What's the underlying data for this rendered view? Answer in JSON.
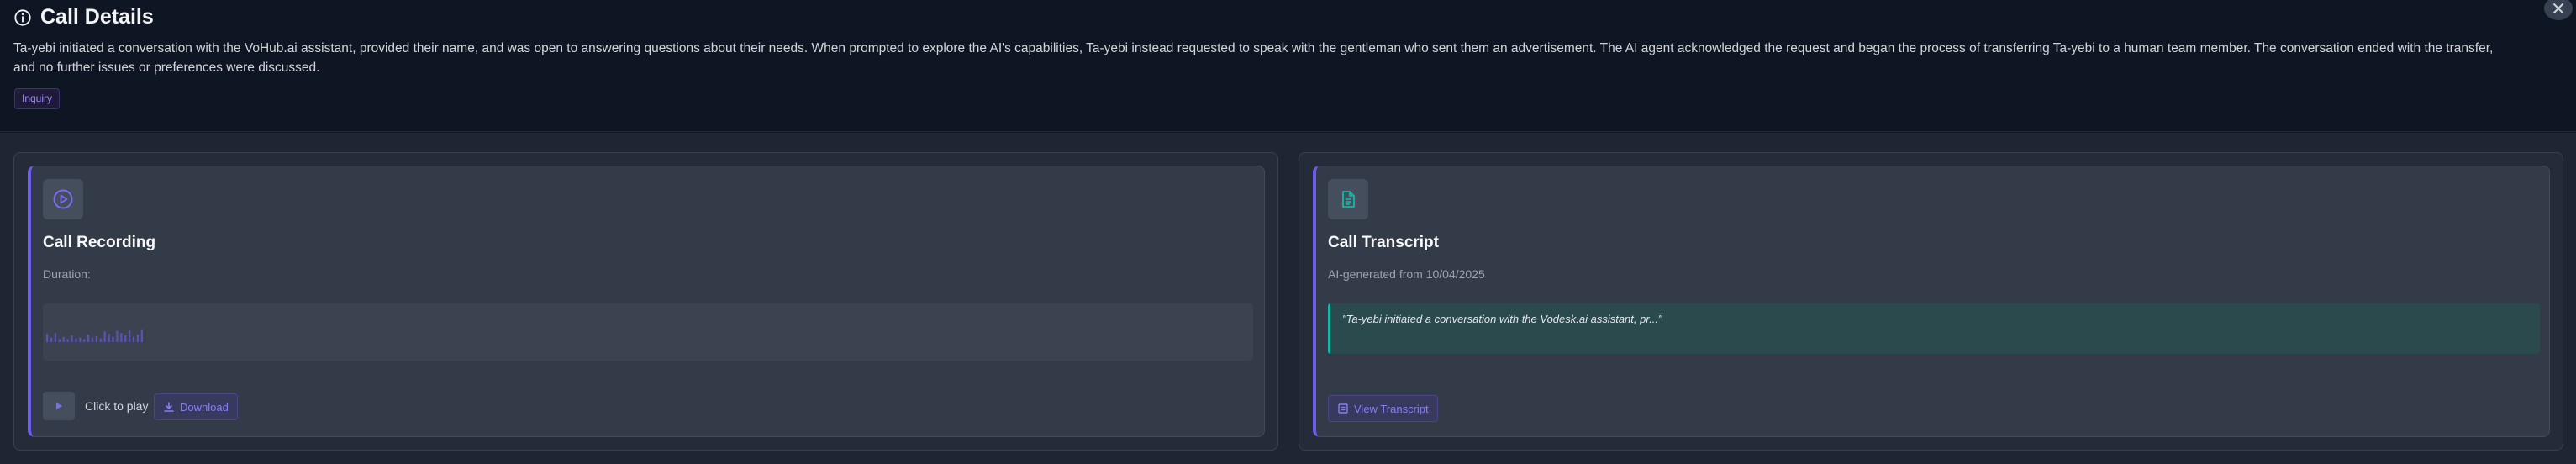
{
  "header": {
    "title": "Call Details",
    "title_icon": "info-icon",
    "summary": "Ta-yebi initiated a conversation with the VoHub.ai assistant, provided their name, and was open to answering questions about their needs. When prompted to explore the AI's capabilities, Ta-yebi instead requested to speak with the gentleman who sent them an advertisement. The AI agent acknowledged the request and began the process of transferring Ta-yebi to a human team member. The conversation ended with the transfer, and no further issues or preferences were discussed.",
    "badge": "Inquiry",
    "close_icon": "close-icon"
  },
  "recording": {
    "title": "Call Recording",
    "duration_label": "Duration:",
    "play_label": "Click to play",
    "download_label": "Download",
    "waveform_levels": [
      0.55,
      0.3,
      0.6,
      0.2,
      0.35,
      0.2,
      0.45,
      0.25,
      0.3,
      0.2,
      0.5,
      0.3,
      0.4,
      0.25,
      0.7,
      0.55,
      0.35,
      0.75,
      0.6,
      0.45,
      0.8,
      0.35,
      0.5,
      0.85
    ]
  },
  "transcript": {
    "title": "Call Transcript",
    "subtitle": "AI-generated from 10/04/2025",
    "quote": "\"Ta-yebi initiated a conversation with the Vodesk.ai assistant, pr...\"",
    "view_label": "View Transcript"
  },
  "colors": {
    "accent": "#6d5ce8",
    "teal": "#14b8a6",
    "bg": "#111827"
  }
}
